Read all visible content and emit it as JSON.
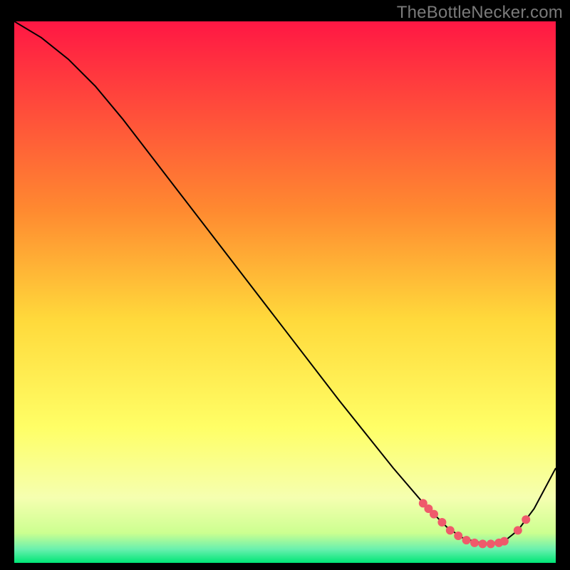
{
  "watermark": "TheBottleNecker.com",
  "chart_data": {
    "type": "line",
    "title": "",
    "xlabel": "",
    "ylabel": "",
    "xlim": [
      0,
      1
    ],
    "ylim": [
      0,
      1
    ],
    "background_gradient": {
      "stops": [
        {
          "offset": 0.0,
          "color": "#ff1744"
        },
        {
          "offset": 0.35,
          "color": "#ff8a30"
        },
        {
          "offset": 0.55,
          "color": "#ffd93b"
        },
        {
          "offset": 0.75,
          "color": "#ffff66"
        },
        {
          "offset": 0.88,
          "color": "#f5ffb0"
        },
        {
          "offset": 0.945,
          "color": "#ccff90"
        },
        {
          "offset": 0.975,
          "color": "#69f0ae"
        },
        {
          "offset": 1.0,
          "color": "#00e676"
        }
      ]
    },
    "curve": [
      {
        "x": 0.0,
        "y": 1.0
      },
      {
        "x": 0.05,
        "y": 0.97
      },
      {
        "x": 0.1,
        "y": 0.93
      },
      {
        "x": 0.15,
        "y": 0.88
      },
      {
        "x": 0.2,
        "y": 0.82
      },
      {
        "x": 0.3,
        "y": 0.69
      },
      {
        "x": 0.4,
        "y": 0.56
      },
      {
        "x": 0.5,
        "y": 0.43
      },
      {
        "x": 0.6,
        "y": 0.3
      },
      {
        "x": 0.7,
        "y": 0.175
      },
      {
        "x": 0.76,
        "y": 0.105
      },
      {
        "x": 0.8,
        "y": 0.065
      },
      {
        "x": 0.83,
        "y": 0.045
      },
      {
        "x": 0.87,
        "y": 0.035
      },
      {
        "x": 0.905,
        "y": 0.04
      },
      {
        "x": 0.93,
        "y": 0.06
      },
      {
        "x": 0.96,
        "y": 0.1
      },
      {
        "x": 1.0,
        "y": 0.175
      }
    ],
    "highlight_points": [
      {
        "x": 0.755,
        "y": 0.11
      },
      {
        "x": 0.765,
        "y": 0.1
      },
      {
        "x": 0.775,
        "y": 0.09
      },
      {
        "x": 0.79,
        "y": 0.075
      },
      {
        "x": 0.805,
        "y": 0.06
      },
      {
        "x": 0.82,
        "y": 0.05
      },
      {
        "x": 0.835,
        "y": 0.042
      },
      {
        "x": 0.85,
        "y": 0.037
      },
      {
        "x": 0.865,
        "y": 0.035
      },
      {
        "x": 0.88,
        "y": 0.035
      },
      {
        "x": 0.895,
        "y": 0.037
      },
      {
        "x": 0.905,
        "y": 0.04
      },
      {
        "x": 0.93,
        "y": 0.06
      },
      {
        "x": 0.945,
        "y": 0.08
      }
    ],
    "highlight_color": "#ef5a6b",
    "curve_color": "#000000"
  }
}
